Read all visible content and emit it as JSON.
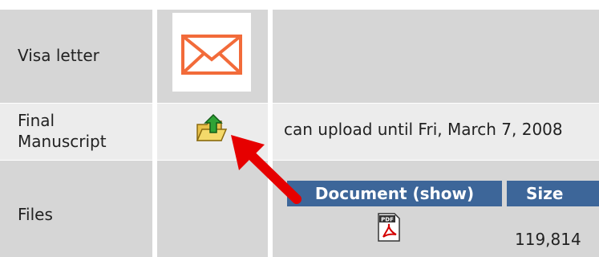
{
  "rows": [
    {
      "label": "Visa letter"
    },
    {
      "label": "Final Manuscript",
      "note": "can upload until Fri, March 7, 2008"
    },
    {
      "label": "Files"
    }
  ],
  "files_table": {
    "headers": {
      "document": "Document (show)",
      "size": "Size"
    },
    "file": {
      "type_icon": "pdf-icon",
      "size": "119,814"
    }
  },
  "icons": {
    "visa": "envelope-icon",
    "upload": "upload-folder-icon",
    "pointer": "red-arrow-icon"
  },
  "colors": {
    "row_dark": "#d6d6d6",
    "row_light": "#ececec",
    "header_blue": "#3d6699",
    "envelope": "#f26b3a",
    "arrow": "#e60000"
  }
}
